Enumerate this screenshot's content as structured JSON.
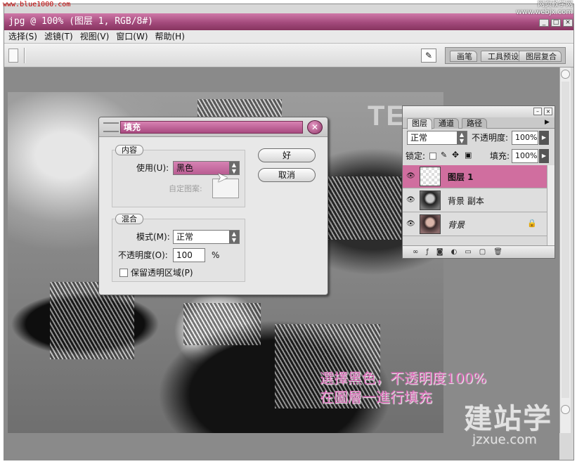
{
  "watermarks": {
    "top_left": "www.blue1000.com",
    "top_right_line1": "网页教学网",
    "top_right_line2": "www.webjx.com",
    "bottom_right_big": "建站学",
    "bottom_right_small": "jzxue.com"
  },
  "window": {
    "title": "jpg @ 100% (图层 1, RGB/8#)",
    "controls": [
      "_",
      "□",
      "×"
    ]
  },
  "menu": {
    "items": [
      "选择(S)",
      "滤镜(T)",
      "视图(V)",
      "窗口(W)",
      "帮助(H)"
    ]
  },
  "options_bar": {
    "palette_well_tabs": [
      "画笔",
      "工具预设",
      "图层复合"
    ]
  },
  "canvas": {
    "image_text": "TE"
  },
  "fill_dialog": {
    "title": "填充",
    "contents_group": "内容",
    "use_label": "使用(U):",
    "use_value": "黑色",
    "custom_pattern_label": "自定图案:",
    "blending_group": "混合",
    "mode_label": "模式(M):",
    "mode_value": "正常",
    "opacity_label": "不透明度(O):",
    "opacity_value": "100",
    "opacity_unit": "%",
    "preserve_transparency_label": "保留透明区域(P)",
    "preserve_transparency_checked": false,
    "ok_label": "好",
    "cancel_label": "取消"
  },
  "layers_panel": {
    "tabs": [
      "图层",
      "通道",
      "路径"
    ],
    "active_tab": "图层",
    "blend_mode": "正常",
    "opacity_label": "不透明度:",
    "opacity_value": "100%",
    "lock_label": "锁定:",
    "fill_label": "填充:",
    "fill_value": "100%",
    "layers": [
      {
        "name": "图层 1",
        "selected": true,
        "visible": true,
        "locked": false
      },
      {
        "name": "背景 副本",
        "selected": false,
        "visible": true,
        "locked": false
      },
      {
        "name": "背景",
        "selected": false,
        "visible": true,
        "locked": true
      }
    ]
  },
  "caption": {
    "line1": "選擇黑色，不透明度100%",
    "line2": "在圖層一進行填充"
  },
  "colors": {
    "accent": "#a84a80",
    "caption": "#d96bb7"
  }
}
